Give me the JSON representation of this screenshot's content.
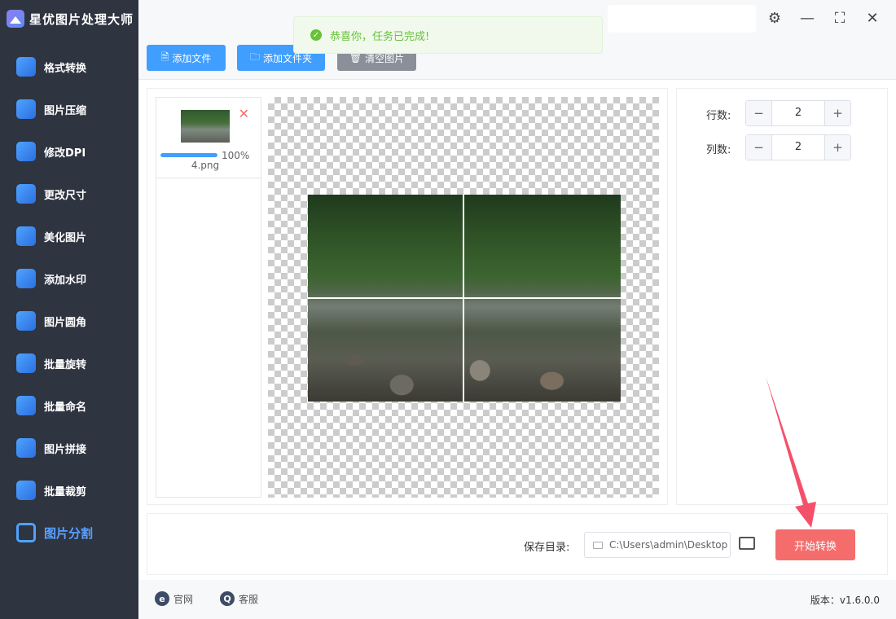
{
  "app": {
    "title": "星优图片处理大师"
  },
  "nav": [
    {
      "label": "格式转换",
      "icon": "image-convert-icon",
      "color": "#4fa3ff"
    },
    {
      "label": "图片压缩",
      "icon": "image-compress-icon",
      "color": "#4fa3ff"
    },
    {
      "label": "修改DPI",
      "icon": "dpi-icon",
      "color": "#4fa3ff"
    },
    {
      "label": "更改尺寸",
      "icon": "resize-icon",
      "color": "#4fa3ff"
    },
    {
      "label": "美化图片",
      "icon": "beautify-icon",
      "color": "#4fa3ff"
    },
    {
      "label": "添加水印",
      "icon": "watermark-icon",
      "color": "#4fa3ff"
    },
    {
      "label": "图片圆角",
      "icon": "round-corner-icon",
      "color": "#4fa3ff"
    },
    {
      "label": "批量旋转",
      "icon": "rotate-icon",
      "color": "#4fa3ff"
    },
    {
      "label": "批量命名",
      "icon": "rename-icon",
      "color": "#4fa3ff"
    },
    {
      "label": "图片拼接",
      "icon": "stitch-icon",
      "color": "#4fa3ff"
    },
    {
      "label": "批量裁剪",
      "icon": "crop-icon",
      "color": "#4fa3ff"
    },
    {
      "label": "图片分割",
      "icon": "split-icon",
      "color": "#4fa3ff",
      "active": true
    }
  ],
  "toolbar": {
    "add_file": "添加文件",
    "add_folder": "添加文件夹",
    "clear": "清空图片"
  },
  "toast": {
    "message": "恭喜你，任务已完成!"
  },
  "file": {
    "name": "4.png",
    "progress_label": "100%",
    "progress": 1.0
  },
  "settings": {
    "rows_label": "行数:",
    "rows_value": "2",
    "cols_label": "列数:",
    "cols_value": "2"
  },
  "output": {
    "label": "保存目录:",
    "path": "C:\\Users\\admin\\Desktop",
    "start": "开始转换"
  },
  "footer": {
    "website": "官网",
    "support": "客服",
    "version": "版本：v1.6.0.0"
  },
  "colors": {
    "accent": "#409eff",
    "danger": "#f56c6c",
    "success": "#67c23a",
    "sidebar": "#2e3440"
  }
}
